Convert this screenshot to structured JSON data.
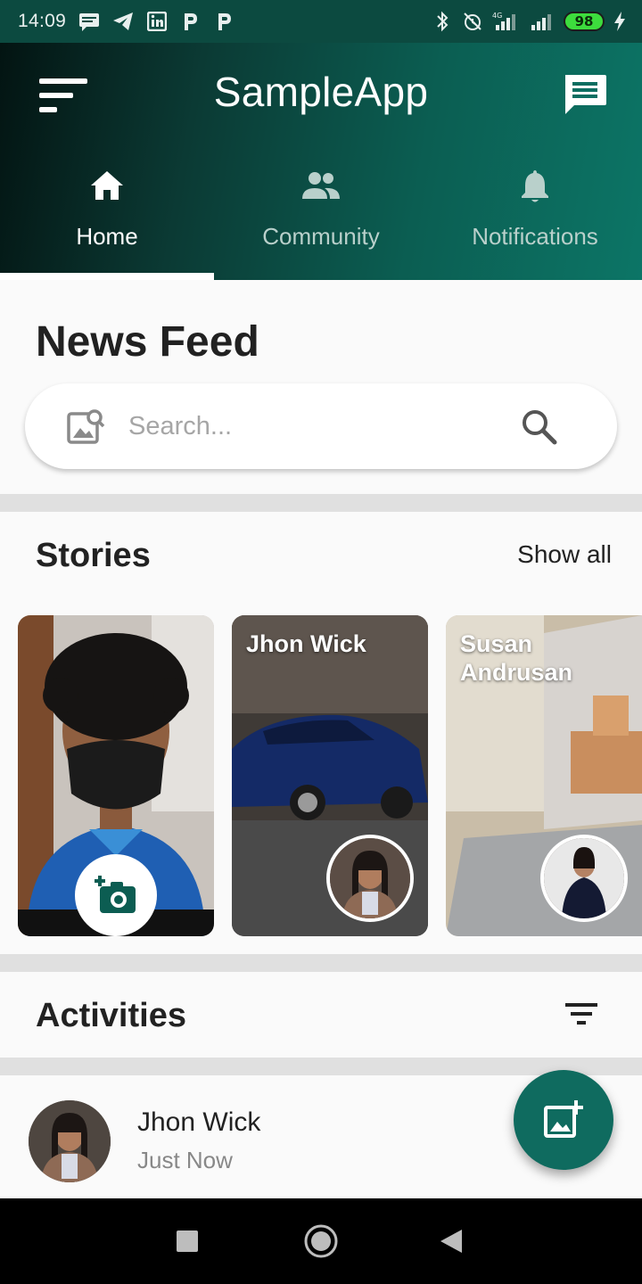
{
  "status_bar": {
    "time": "14:09",
    "battery": "98",
    "left_icons": [
      "message-icon",
      "telegram-icon",
      "linkedin-icon",
      "p-icon",
      "p-icon"
    ],
    "right_icons": [
      "bluetooth-icon",
      "alarm-off-icon",
      "signal-4g-icon",
      "signal-icon",
      "battery-icon",
      "charging-icon"
    ]
  },
  "header": {
    "title": "SampleApp",
    "menu_icon": "sort-menu-icon",
    "chat_icon": "chat-icon",
    "tabs": [
      {
        "label": "Home",
        "icon": "home-icon",
        "active": true
      },
      {
        "label": "Community",
        "icon": "people-icon",
        "active": false
      },
      {
        "label": "Notifications",
        "icon": "bell-icon",
        "active": false
      }
    ]
  },
  "feed": {
    "title": "News Feed",
    "search_placeholder": "Search..."
  },
  "stories": {
    "title": "Stories",
    "show_all": "Show all",
    "items": [
      {
        "name": "",
        "type": "add-story"
      },
      {
        "name": "Jhon Wick",
        "type": "story"
      },
      {
        "name": "Susan Andrusan",
        "type": "story"
      }
    ]
  },
  "activities": {
    "title": "Activities",
    "items": [
      {
        "name": "Jhon Wick",
        "time": "Just Now"
      }
    ]
  },
  "colors": {
    "accent": "#0f6b5f",
    "header_dark": "#031412",
    "header_light": "#0c7566"
  }
}
